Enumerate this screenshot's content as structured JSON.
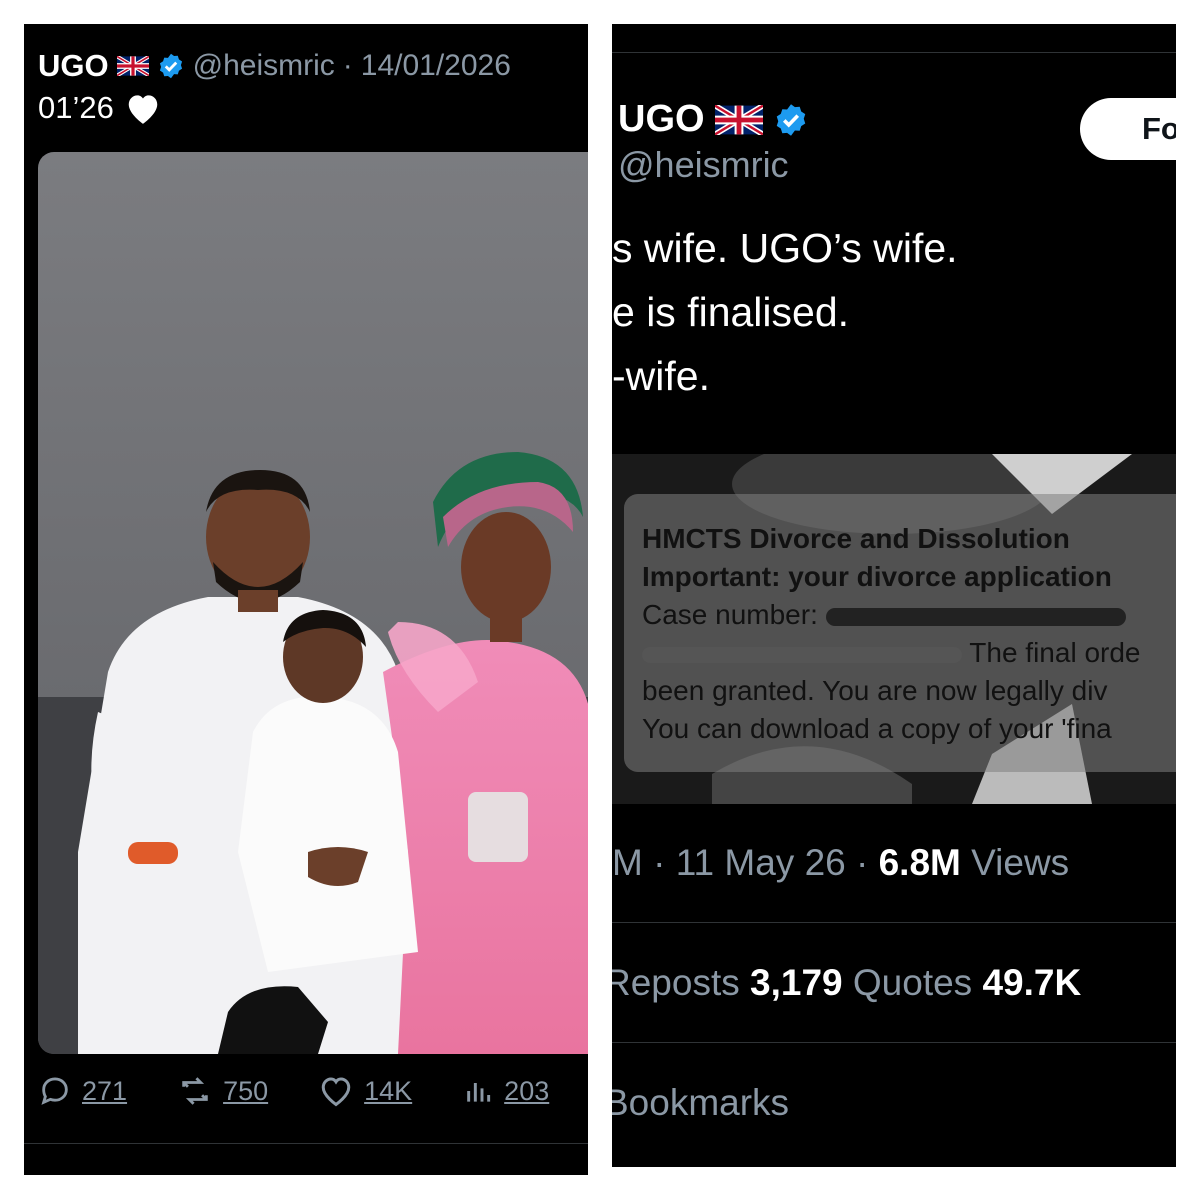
{
  "left_tweet": {
    "display_name": "UGO",
    "flag_icon": "uk-flag-icon",
    "handle": "@heismric",
    "separator": "·",
    "date": "14/01/2026",
    "text": "01’26",
    "heart_icon": "white-heart-icon",
    "replies": "271",
    "reposts": "750",
    "likes": "14K",
    "views": "203"
  },
  "right_tweet": {
    "display_name": "UGO",
    "handle": "@heismric",
    "follow_label": "Fo",
    "text_lines": [
      "s wife. UGO’s wife.",
      "e is finalised.",
      "-wife."
    ],
    "notification": {
      "title": "HMCTS Divorce and Dissolution",
      "subtitle": "Important: your divorce application",
      "case_line": "Case number:",
      "final_order": "The final orde",
      "granted_line": "been granted. You are now legally div",
      "download_line": "You can download a copy of your 'fina"
    },
    "time_fragment": "M · 11 May 26 · ",
    "views_count": "6.8M",
    "views_label": " Views",
    "reposts_label": "Reposts  ",
    "quotes_count": "3,179",
    "quotes_label": " Quotes  ",
    "likes_count": "49.7K",
    "bookmarks_label": "Bookmarks"
  },
  "colors": {
    "background": "#000000",
    "verified_blue": "#1d9bf0",
    "muted_text": "#8b98a5",
    "pink_dress": "#e87aa8",
    "wall_gray": "#7a7b80"
  }
}
